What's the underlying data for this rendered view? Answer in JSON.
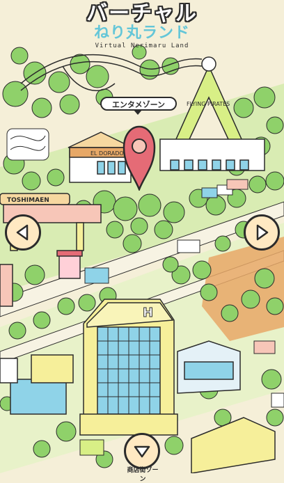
{
  "logo": {
    "title_top": "バーチャル",
    "title_mid": "ねり丸ランド",
    "subtitle": "Virtual Nerimaru Land"
  },
  "map": {
    "area_label": "エンタメゾーン",
    "signs": {
      "toshimaen": "TOSHIMAEN",
      "el_dorado": "EL DORADO",
      "flying_pirates": "FLYING PIRATES"
    }
  },
  "nav": {
    "left_icon": "chevron-left-icon",
    "right_icon": "chevron-right-icon",
    "down_icon": "chevron-down-icon",
    "down_label": "商店街ゾーン"
  },
  "colors": {
    "tree_green": "#8fd16a",
    "tree_dark": "#5fb14a",
    "ground": "#f5efd8",
    "road": "#f7f3e3",
    "building_yellow": "#f6ef9a",
    "glass_blue": "#8fd3e8",
    "pin_red": "#e56b76",
    "button_bg": "#ffe9c2",
    "accent_orange": "#e7a867"
  }
}
